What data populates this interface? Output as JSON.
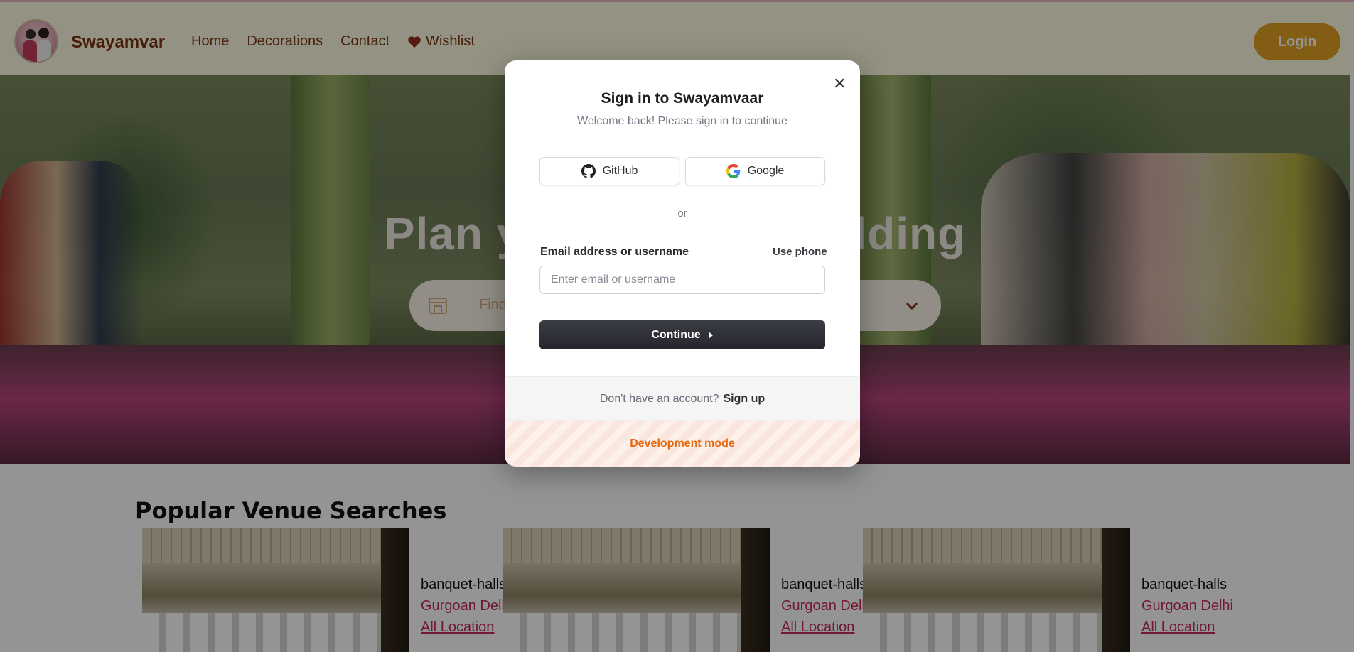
{
  "navbar": {
    "brand": "Swayamvar",
    "links": [
      "Home",
      "Decorations",
      "Contact"
    ],
    "wishlist_label": "Wishlist",
    "login_label": "Login"
  },
  "hero": {
    "title": "Plan your Dream Wedding",
    "search_placeholder": "Find"
  },
  "popular": {
    "title": "Popular Venue Searches",
    "cards": [
      {
        "category": "banquet-halls",
        "locations": "Gurgoan  Delhi",
        "all_link": "All Location"
      },
      {
        "category": "banquet-halls",
        "locations": "Gurgoan  Delhi",
        "all_link": "All Location"
      },
      {
        "category": "banquet-halls",
        "locations": "Gurgoan  Delhi",
        "all_link": "All Location"
      }
    ]
  },
  "modal": {
    "title": "Sign in to Swayamvaar",
    "subtitle": "Welcome back! Please sign in to continue",
    "github_label": "GitHub",
    "google_label": "Google",
    "divider": "or",
    "email_label": "Email address or username",
    "use_phone": "Use phone",
    "email_placeholder": "Enter email or username",
    "continue_label": "Continue",
    "no_account": "Don't have an account?",
    "signup_label": "Sign up",
    "dev_mode": "Development mode"
  },
  "colors": {
    "brand": "#7a3514",
    "login_button": "#e0a021",
    "location_link": "#c32b55",
    "dev_mode": "#e5680e"
  }
}
